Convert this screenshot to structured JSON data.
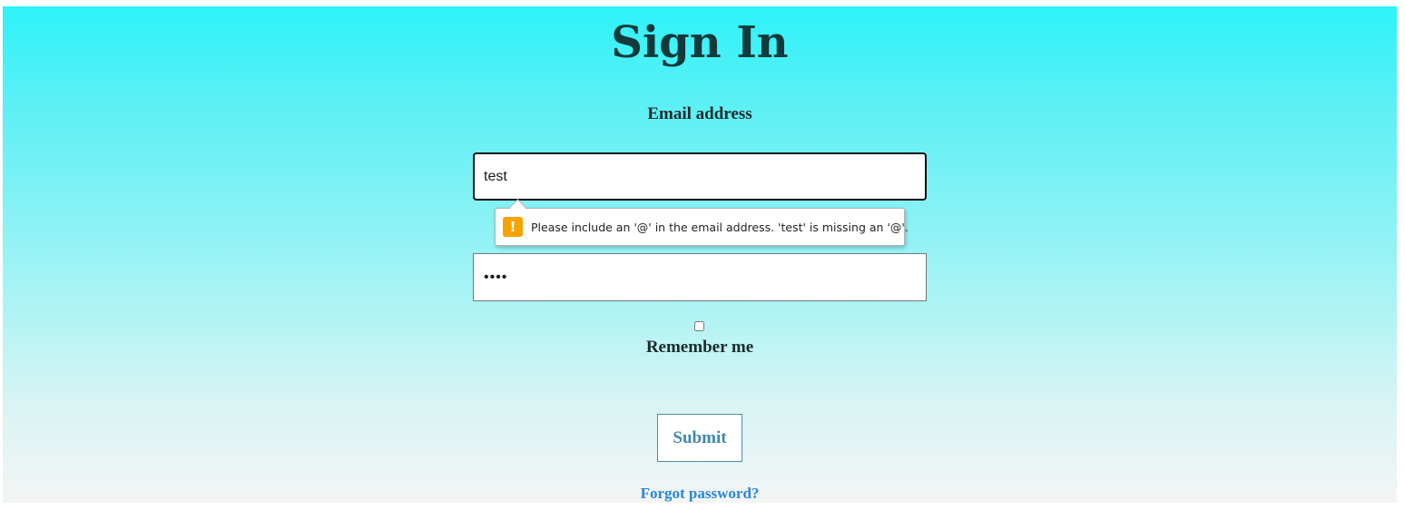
{
  "form": {
    "title": "Sign In",
    "email_label": "Email address",
    "email_value": "test",
    "password_masked": "••••",
    "remember_label": "Remember me",
    "remember_checked": false,
    "submit_label": "Submit",
    "forgot_label": "Forgot password?"
  },
  "validation": {
    "icon": "warning-icon",
    "icon_glyph": "!",
    "message": "Please include an '@' in the email address. 'test' is missing an '@'."
  },
  "colors": {
    "gradient_top": "#2df3f8",
    "gradient_bottom": "#f3f5f4",
    "warning": "#f5a300",
    "link": "#2a86d8",
    "submit_text": "#3f87ad"
  }
}
